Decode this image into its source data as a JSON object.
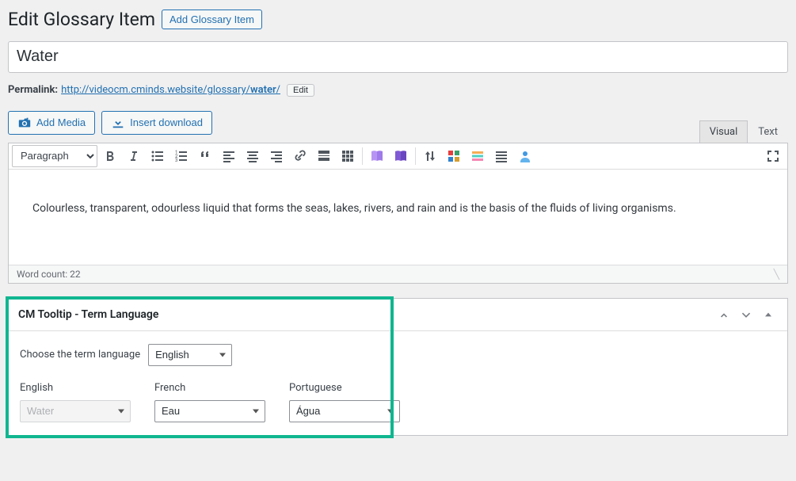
{
  "header": {
    "page_title": "Edit Glossary Item",
    "add_button": "Add Glossary Item"
  },
  "post": {
    "title_value": "Water",
    "permalink_label": "Permalink:",
    "permalink_base": "http://videocm.cminds.website/glossary/",
    "permalink_slug": "water",
    "permalink_trail": "/",
    "edit_slug_button": "Edit"
  },
  "editor": {
    "add_media_button": "Add Media",
    "insert_download_button": "Insert download",
    "format_selected": "Paragraph",
    "tabs": {
      "visual": "Visual",
      "text": "Text"
    },
    "content": "Colourless, transparent, odourless liquid that forms the seas, lakes, rivers, and rain and is the basis of the fluids of living organisms.",
    "word_count_label": "Word count: 22"
  },
  "lang_box": {
    "title": "CM Tooltip - Term Language",
    "choose_label": "Choose the term language",
    "choose_selected": "English",
    "cols": {
      "english": {
        "label": "English",
        "value": "Water"
      },
      "french": {
        "label": "French",
        "value": "Eau"
      },
      "portuguese": {
        "label": "Portuguese",
        "value": "Água"
      }
    }
  }
}
